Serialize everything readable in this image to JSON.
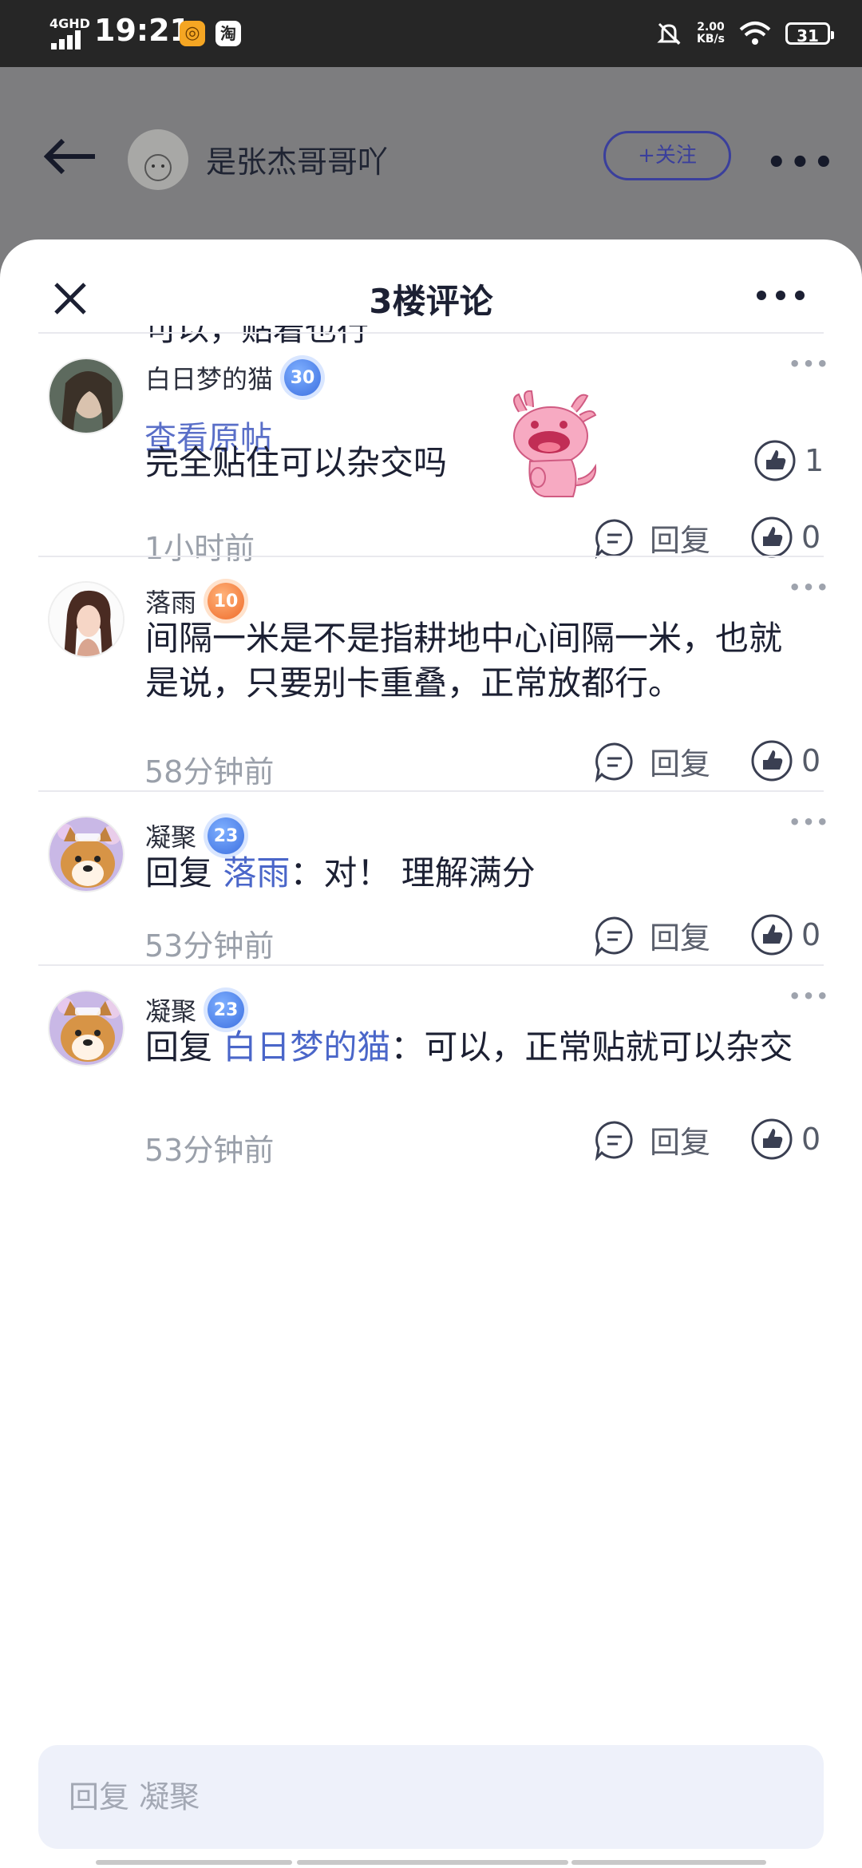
{
  "status_bar": {
    "network": "4GHD",
    "time": "19:21",
    "app1": "◎",
    "app2": "淘",
    "speed_value": "2.00",
    "speed_unit": "KB/s",
    "battery": "31"
  },
  "post_header": {
    "author": "是张杰哥哥吖",
    "follow_label": "+关注"
  },
  "sheet": {
    "title": "3楼评论",
    "cutoff_text": "可以，贴着也行",
    "view_original": "查看原帖",
    "top_like_count": "1",
    "reply_placeholder": "回复 凝聚"
  },
  "comments": [
    {
      "user": "白日梦的猫",
      "level": "30",
      "level_color": "#3c6fe0",
      "text": "完全贴住可以杂交吗",
      "time": "1小时前",
      "reply_label": "回复",
      "likes": "0"
    },
    {
      "user": "落雨",
      "level": "10",
      "level_color": "#ef6b2a",
      "text": "间隔一米是不是指耕地中心间隔一米，也就是说，只要别卡重叠，正常放都行。",
      "time": "58分钟前",
      "reply_label": "回复",
      "likes": "0"
    },
    {
      "user": "凝聚",
      "level": "23",
      "level_color": "#3c6fe0",
      "reply_prefix": "回复",
      "reply_to": "落雨",
      "text": "：对！ 理解满分",
      "time": "53分钟前",
      "reply_label": "回复",
      "likes": "0"
    },
    {
      "user": "凝聚",
      "level": "23",
      "level_color": "#3c6fe0",
      "reply_prefix": "回复",
      "reply_to": "白日梦的猫",
      "text": "：可以，正常贴就可以杂交",
      "time": "53分钟前",
      "reply_label": "回复",
      "likes": "0"
    }
  ]
}
